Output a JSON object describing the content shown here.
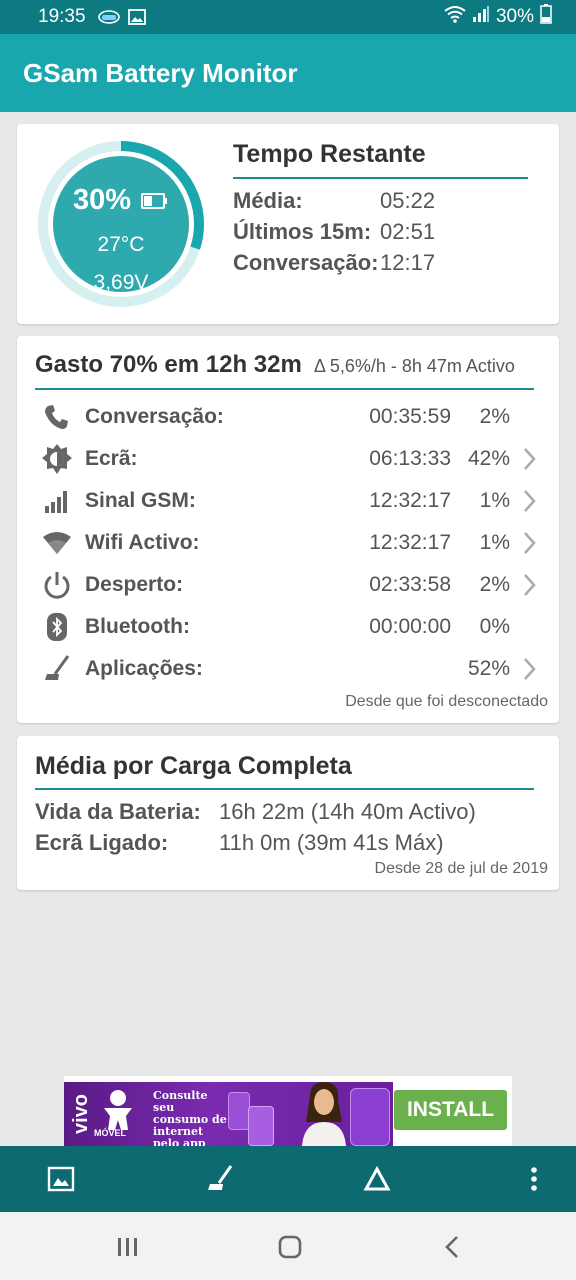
{
  "status_bar": {
    "time": "19:35",
    "battery_text": "30%",
    "icons": [
      "app-badge-icon",
      "image-icon",
      "wifi-icon",
      "signal-icon",
      "battery-icon"
    ]
  },
  "app_bar": {
    "title": "GSam Battery Monitor"
  },
  "battery_gauge": {
    "percent_text": "30%",
    "level": 0.3,
    "temperature": "27°C",
    "voltage": "3,69V"
  },
  "tempo_restante": {
    "title": "Tempo Restante",
    "rows": [
      {
        "label": "Média:",
        "value": "05:22"
      },
      {
        "label": "Últimos 15m:",
        "value": "02:51"
      },
      {
        "label": "Conversação:",
        "value": "12:17"
      }
    ]
  },
  "gasto": {
    "title": "Gasto 70% em 12h 32m",
    "subtitle": "Δ 5,6%/h - 8h 47m Activo",
    "rows": [
      {
        "icon": "phone-icon",
        "label": "Conversação:",
        "duration": "00:35:59",
        "percent": "2%",
        "has_chevron": false
      },
      {
        "icon": "brightness-icon",
        "label": "Ecrã:",
        "duration": "06:13:33",
        "percent": "42%",
        "has_chevron": true
      },
      {
        "icon": "signal-bars-icon",
        "label": "Sinal GSM:",
        "duration": "12:32:17",
        "percent": "1%",
        "has_chevron": true
      },
      {
        "icon": "wifi-icon",
        "label": "Wifi Activo:",
        "duration": "12:32:17",
        "percent": "1%",
        "has_chevron": true
      },
      {
        "icon": "power-icon",
        "label": "Desperto:",
        "duration": "02:33:58",
        "percent": "2%",
        "has_chevron": true
      },
      {
        "icon": "bluetooth-icon",
        "label": "Bluetooth:",
        "duration": "00:00:00",
        "percent": "0%",
        "has_chevron": false
      },
      {
        "icon": "broom-icon",
        "label": "Aplicações:",
        "duration": "",
        "percent": "52%",
        "has_chevron": true
      }
    ],
    "footnote": "Desde que foi desconectado"
  },
  "media_carga": {
    "title": "Média por Carga Completa",
    "rows": [
      {
        "label": "Vida da Bateria:",
        "value": "16h 22m (14h 40m Activo)"
      },
      {
        "label": "Ecrã Ligado:",
        "value": "11h 0m (39m 41s Máx)"
      }
    ],
    "footnote": "Desde 28 de jul de 2019"
  },
  "ad": {
    "brand": "vivo",
    "brand_sub": "MÓVEL",
    "text": "Consulte seu consumo de internet pelo app Meu Vivo.",
    "install_label": "INSTALL"
  },
  "bottom_toolbar": {
    "icons": [
      "image-icon",
      "broom-icon",
      "delta-icon",
      "more-vert-icon"
    ]
  },
  "nav_bar": {
    "icons": [
      "recents-icon",
      "home-icon",
      "back-icon"
    ]
  },
  "colors": {
    "status_bar": "#0c7a80",
    "app_bar": "#1aa6ad",
    "accent_line": "#1a8c92",
    "gauge_fill": "#2ea9ae",
    "bottom_bar": "#0c6a70",
    "install_button": "#6ab04c"
  }
}
